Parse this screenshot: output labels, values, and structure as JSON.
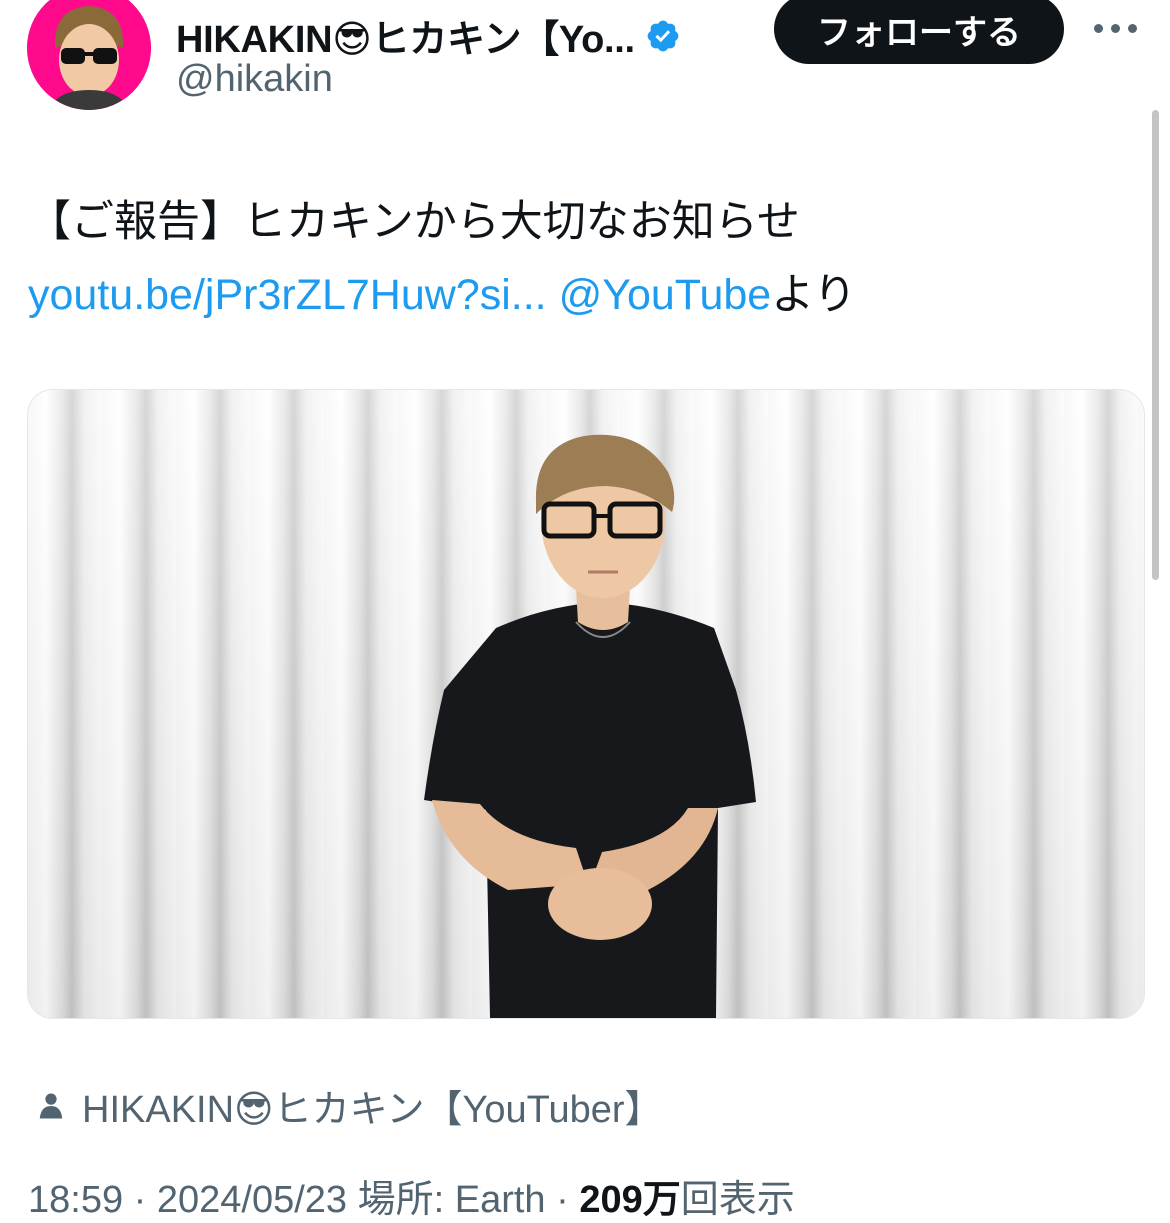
{
  "header": {
    "display_name": "HIKAKIN😎ヒカキン【Yo...",
    "handle": "@hikakin",
    "follow_label": "フォローする",
    "verified": true
  },
  "tweet": {
    "text_plain": "【ご報告】ヒカキンから大切なお知らせ ",
    "link_text": "youtu.be/jPr3rZL7Huw?si...",
    "mention": "@YouTube",
    "suffix": "より"
  },
  "attribution": {
    "label": "HIKAKIN😎ヒカキン【YouTuber】"
  },
  "meta": {
    "time": "18:59",
    "date": "2024/05/23",
    "location_label": "場所: Earth",
    "views_count": "209万",
    "views_label": "回表示",
    "separator": " · "
  },
  "colors": {
    "link": "#1d9bf0",
    "text": "#0f1419",
    "muted": "#536471",
    "avatar_bg": "#ff0a8c",
    "button_bg": "#0f1419"
  },
  "icons": {
    "verified": "verified-badge-icon",
    "more": "more-horizontal-icon",
    "person": "person-icon"
  }
}
